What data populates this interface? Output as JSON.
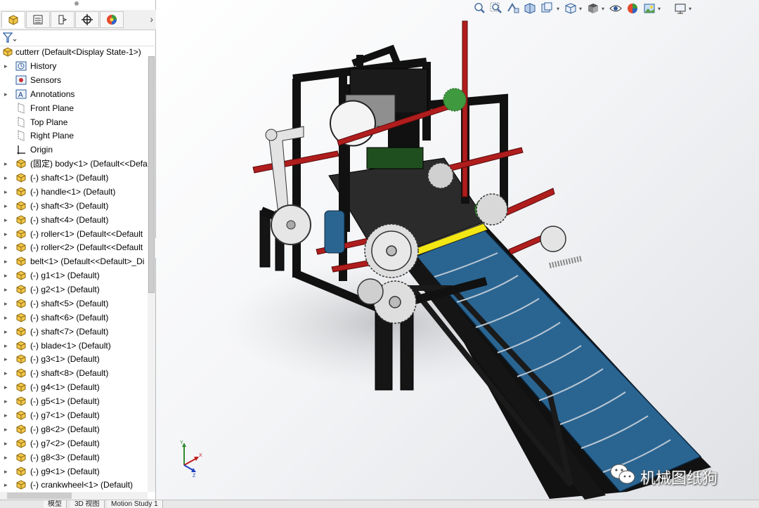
{
  "tree": {
    "root": "cutterr  (Default<Display State-1>)",
    "items": [
      {
        "label": "History",
        "icon": "history-icon",
        "expandable": true
      },
      {
        "label": "Sensors",
        "icon": "sensors-icon",
        "expandable": false
      },
      {
        "label": "Annotations",
        "icon": "annotations-icon",
        "expandable": true
      },
      {
        "label": "Front Plane",
        "icon": "plane-icon",
        "expandable": false
      },
      {
        "label": "Top Plane",
        "icon": "plane-icon",
        "expandable": false
      },
      {
        "label": "Right Plane",
        "icon": "plane-icon",
        "expandable": false
      },
      {
        "label": "Origin",
        "icon": "origin-icon",
        "expandable": false
      },
      {
        "label": "(固定) body<1> (Default<<Defa",
        "icon": "part-icon",
        "expandable": true
      },
      {
        "label": "(-) shaft<1> (Default)",
        "icon": "part-icon",
        "expandable": true
      },
      {
        "label": "(-) handle<1> (Default)",
        "icon": "part-icon",
        "expandable": true
      },
      {
        "label": "(-) shaft<3> (Default)",
        "icon": "part-icon",
        "expandable": true
      },
      {
        "label": "(-) shaft<4> (Default)",
        "icon": "part-icon",
        "expandable": true
      },
      {
        "label": "(-) roller<1> (Default<<Default",
        "icon": "part-icon",
        "expandable": true
      },
      {
        "label": "(-) roller<2> (Default<<Default",
        "icon": "part-icon",
        "expandable": true
      },
      {
        "label": "belt<1> (Default<<Default>_Di",
        "icon": "part-icon",
        "expandable": true
      },
      {
        "label": "(-) g1<1> (Default)",
        "icon": "part-icon",
        "expandable": true
      },
      {
        "label": "(-) g2<1> (Default)",
        "icon": "part-icon",
        "expandable": true
      },
      {
        "label": "(-) shaft<5> (Default)",
        "icon": "part-icon",
        "expandable": true
      },
      {
        "label": "(-) shaft<6> (Default)",
        "icon": "part-icon",
        "expandable": true
      },
      {
        "label": "(-) shaft<7> (Default)",
        "icon": "part-icon",
        "expandable": true
      },
      {
        "label": "(-) blade<1> (Default)",
        "icon": "part-icon",
        "expandable": true
      },
      {
        "label": "(-) g3<1> (Default)",
        "icon": "part-icon",
        "expandable": true
      },
      {
        "label": "(-) shaft<8> (Default)",
        "icon": "part-icon",
        "expandable": true
      },
      {
        "label": "(-) g4<1> (Default)",
        "icon": "part-icon",
        "expandable": true
      },
      {
        "label": "(-) g5<1> (Default)",
        "icon": "part-icon",
        "expandable": true
      },
      {
        "label": "(-) g7<1> (Default)",
        "icon": "part-icon",
        "expandable": true
      },
      {
        "label": "(-) g8<2> (Default)",
        "icon": "part-icon",
        "expandable": true
      },
      {
        "label": "(-) g7<2> (Default)",
        "icon": "part-icon",
        "expandable": true
      },
      {
        "label": "(-) g8<3> (Default)",
        "icon": "part-icon",
        "expandable": true
      },
      {
        "label": "(-) g9<1> (Default)",
        "icon": "part-icon",
        "expandable": true
      },
      {
        "label": "(-) crankwheel<1> (Default)",
        "icon": "part-icon",
        "expandable": true
      }
    ]
  },
  "bottom_tabs": [
    "模型",
    "3D 视图",
    "Motion Study 1"
  ],
  "watermark": "机械图纸狗",
  "triad": {
    "x": "X",
    "y": "Y",
    "z": "Z"
  },
  "colors": {
    "belt": "#2a6592",
    "frame": "#111111",
    "shaft": "#b01d1d",
    "stripe": "#f2e614",
    "gear": "#dcdcdc"
  }
}
